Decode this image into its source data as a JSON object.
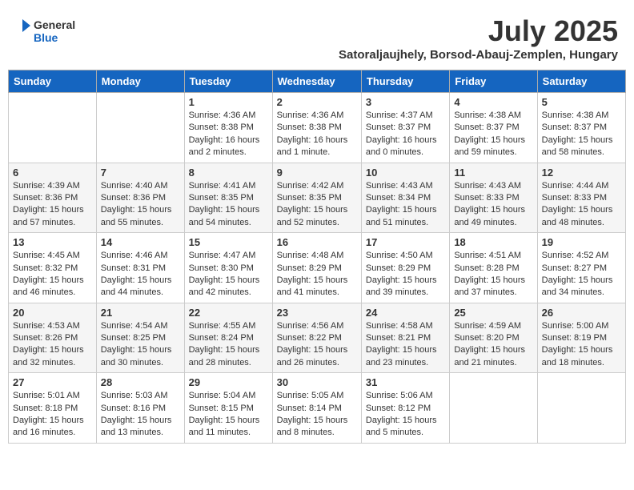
{
  "header": {
    "logo_general": "General",
    "logo_blue": "Blue",
    "month_title": "July 2025",
    "location": "Satoraljaujhely, Borsod-Abauj-Zemplen, Hungary"
  },
  "weekdays": [
    "Sunday",
    "Monday",
    "Tuesday",
    "Wednesday",
    "Thursday",
    "Friday",
    "Saturday"
  ],
  "weeks": [
    [
      {
        "day": "",
        "info": ""
      },
      {
        "day": "",
        "info": ""
      },
      {
        "day": "1",
        "info": "Sunrise: 4:36 AM\nSunset: 8:38 PM\nDaylight: 16 hours\nand 2 minutes."
      },
      {
        "day": "2",
        "info": "Sunrise: 4:36 AM\nSunset: 8:38 PM\nDaylight: 16 hours\nand 1 minute."
      },
      {
        "day": "3",
        "info": "Sunrise: 4:37 AM\nSunset: 8:37 PM\nDaylight: 16 hours\nand 0 minutes."
      },
      {
        "day": "4",
        "info": "Sunrise: 4:38 AM\nSunset: 8:37 PM\nDaylight: 15 hours\nand 59 minutes."
      },
      {
        "day": "5",
        "info": "Sunrise: 4:38 AM\nSunset: 8:37 PM\nDaylight: 15 hours\nand 58 minutes."
      }
    ],
    [
      {
        "day": "6",
        "info": "Sunrise: 4:39 AM\nSunset: 8:36 PM\nDaylight: 15 hours\nand 57 minutes."
      },
      {
        "day": "7",
        "info": "Sunrise: 4:40 AM\nSunset: 8:36 PM\nDaylight: 15 hours\nand 55 minutes."
      },
      {
        "day": "8",
        "info": "Sunrise: 4:41 AM\nSunset: 8:35 PM\nDaylight: 15 hours\nand 54 minutes."
      },
      {
        "day": "9",
        "info": "Sunrise: 4:42 AM\nSunset: 8:35 PM\nDaylight: 15 hours\nand 52 minutes."
      },
      {
        "day": "10",
        "info": "Sunrise: 4:43 AM\nSunset: 8:34 PM\nDaylight: 15 hours\nand 51 minutes."
      },
      {
        "day": "11",
        "info": "Sunrise: 4:43 AM\nSunset: 8:33 PM\nDaylight: 15 hours\nand 49 minutes."
      },
      {
        "day": "12",
        "info": "Sunrise: 4:44 AM\nSunset: 8:33 PM\nDaylight: 15 hours\nand 48 minutes."
      }
    ],
    [
      {
        "day": "13",
        "info": "Sunrise: 4:45 AM\nSunset: 8:32 PM\nDaylight: 15 hours\nand 46 minutes."
      },
      {
        "day": "14",
        "info": "Sunrise: 4:46 AM\nSunset: 8:31 PM\nDaylight: 15 hours\nand 44 minutes."
      },
      {
        "day": "15",
        "info": "Sunrise: 4:47 AM\nSunset: 8:30 PM\nDaylight: 15 hours\nand 42 minutes."
      },
      {
        "day": "16",
        "info": "Sunrise: 4:48 AM\nSunset: 8:29 PM\nDaylight: 15 hours\nand 41 minutes."
      },
      {
        "day": "17",
        "info": "Sunrise: 4:50 AM\nSunset: 8:29 PM\nDaylight: 15 hours\nand 39 minutes."
      },
      {
        "day": "18",
        "info": "Sunrise: 4:51 AM\nSunset: 8:28 PM\nDaylight: 15 hours\nand 37 minutes."
      },
      {
        "day": "19",
        "info": "Sunrise: 4:52 AM\nSunset: 8:27 PM\nDaylight: 15 hours\nand 34 minutes."
      }
    ],
    [
      {
        "day": "20",
        "info": "Sunrise: 4:53 AM\nSunset: 8:26 PM\nDaylight: 15 hours\nand 32 minutes."
      },
      {
        "day": "21",
        "info": "Sunrise: 4:54 AM\nSunset: 8:25 PM\nDaylight: 15 hours\nand 30 minutes."
      },
      {
        "day": "22",
        "info": "Sunrise: 4:55 AM\nSunset: 8:24 PM\nDaylight: 15 hours\nand 28 minutes."
      },
      {
        "day": "23",
        "info": "Sunrise: 4:56 AM\nSunset: 8:22 PM\nDaylight: 15 hours\nand 26 minutes."
      },
      {
        "day": "24",
        "info": "Sunrise: 4:58 AM\nSunset: 8:21 PM\nDaylight: 15 hours\nand 23 minutes."
      },
      {
        "day": "25",
        "info": "Sunrise: 4:59 AM\nSunset: 8:20 PM\nDaylight: 15 hours\nand 21 minutes."
      },
      {
        "day": "26",
        "info": "Sunrise: 5:00 AM\nSunset: 8:19 PM\nDaylight: 15 hours\nand 18 minutes."
      }
    ],
    [
      {
        "day": "27",
        "info": "Sunrise: 5:01 AM\nSunset: 8:18 PM\nDaylight: 15 hours\nand 16 minutes."
      },
      {
        "day": "28",
        "info": "Sunrise: 5:03 AM\nSunset: 8:16 PM\nDaylight: 15 hours\nand 13 minutes."
      },
      {
        "day": "29",
        "info": "Sunrise: 5:04 AM\nSunset: 8:15 PM\nDaylight: 15 hours\nand 11 minutes."
      },
      {
        "day": "30",
        "info": "Sunrise: 5:05 AM\nSunset: 8:14 PM\nDaylight: 15 hours\nand 8 minutes."
      },
      {
        "day": "31",
        "info": "Sunrise: 5:06 AM\nSunset: 8:12 PM\nDaylight: 15 hours\nand 5 minutes."
      },
      {
        "day": "",
        "info": ""
      },
      {
        "day": "",
        "info": ""
      }
    ]
  ]
}
